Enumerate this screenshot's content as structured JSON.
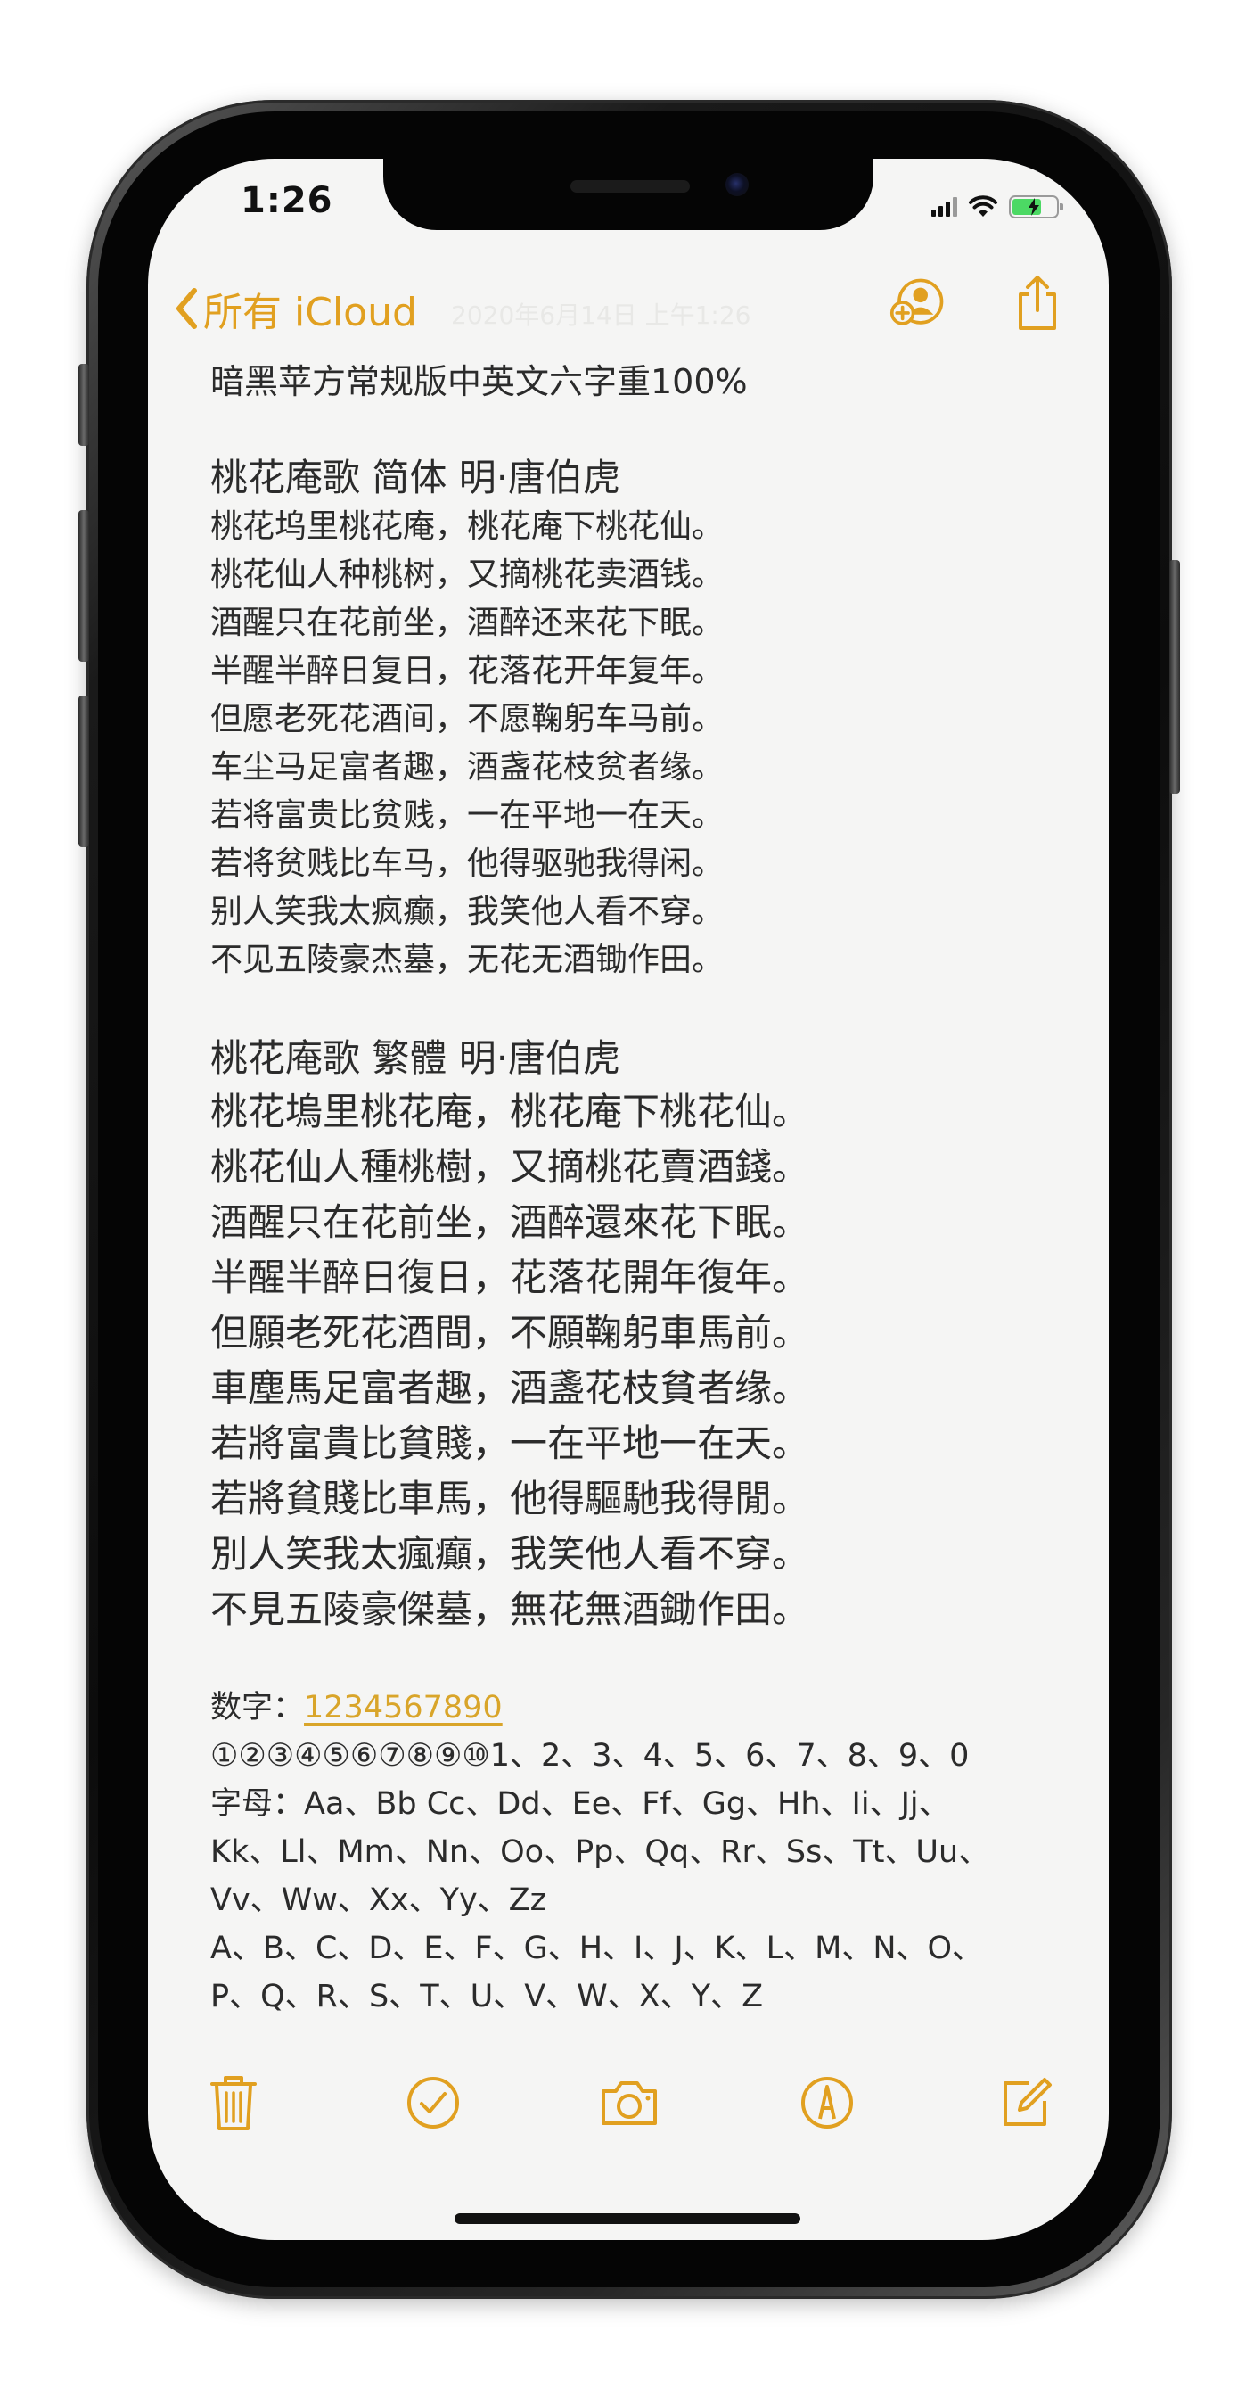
{
  "status_bar": {
    "time": "1:26"
  },
  "nav": {
    "back_label": "所有 iCloud",
    "date": "2020年6月14日 上午1:26"
  },
  "note": {
    "heading": "暗黑苹方常规版中英文六字重100%",
    "simplified": {
      "title": "桃花庵歌 简体  明·唐伯虎",
      "lines": [
        "桃花坞里桃花庵，桃花庵下桃花仙。",
        "桃花仙人种桃树，又摘桃花卖酒钱。",
        "酒醒只在花前坐，酒醉还来花下眠。",
        "半醒半醉日复日，花落花开年复年。",
        "但愿老死花酒间，不愿鞠躬车马前。",
        "车尘马足富者趣，酒盏花枝贫者缘。",
        "若将富贵比贫贱，一在平地一在天。",
        "若将贫贱比车马，他得驱驰我得闲。",
        "别人笑我太疯癫，我笑他人看不穿。",
        "不见五陵豪杰墓，无花无酒锄作田。"
      ]
    },
    "traditional": {
      "title": "桃花庵歌 繁體   明·唐伯虎",
      "lines": [
        "桃花塢里桃花庵，桃花庵下桃花仙。",
        "桃花仙人種桃樹，又摘桃花賣酒錢。",
        "酒醒只在花前坐，酒醉還來花下眠。",
        "半醒半醉日復日，花落花開年復年。",
        "但願老死花酒間，不願鞠躬車馬前。",
        "車塵馬足富者趣，酒盞花枝貧者缘。",
        "若將富貴比貧賤，一在平地一在天。",
        "若將貧賤比車馬，他得驅馳我得閒。",
        "別人笑我太瘋癲，我笑他人看不穿。",
        "不見五陵豪傑墓，無花無酒鋤作田。"
      ]
    },
    "digits_label": "数字：",
    "digits_link": "1234567890",
    "circled_numbers": "①②③④⑤⑥⑦⑧⑨⑩1、2、3、4、5、6、7、8、9、0",
    "letters_lines": [
      "字母：Aa、Bb Cc、Dd、Ee、Ff、Gg、Hh、Ii、Jj、",
      "Kk、Ll、Mm、Nn、Oo、Pp、Qq、Rr、Ss、Tt、Uu、",
      "Vv、Ww、Xx、Yy、Zz",
      "A、B、C、D、E、F、G、H、I、J、K、L、M、N、O、",
      "P、Q、R、S、T、U、V、W、X、Y、Z"
    ]
  },
  "toolbar": {
    "icons": [
      "trash-icon",
      "checklist-icon",
      "camera-icon",
      "markup-icon",
      "compose-icon"
    ]
  },
  "colors": {
    "accent": "#e1a020",
    "background": "#f5f5f4",
    "text": "#2b2b2b"
  }
}
